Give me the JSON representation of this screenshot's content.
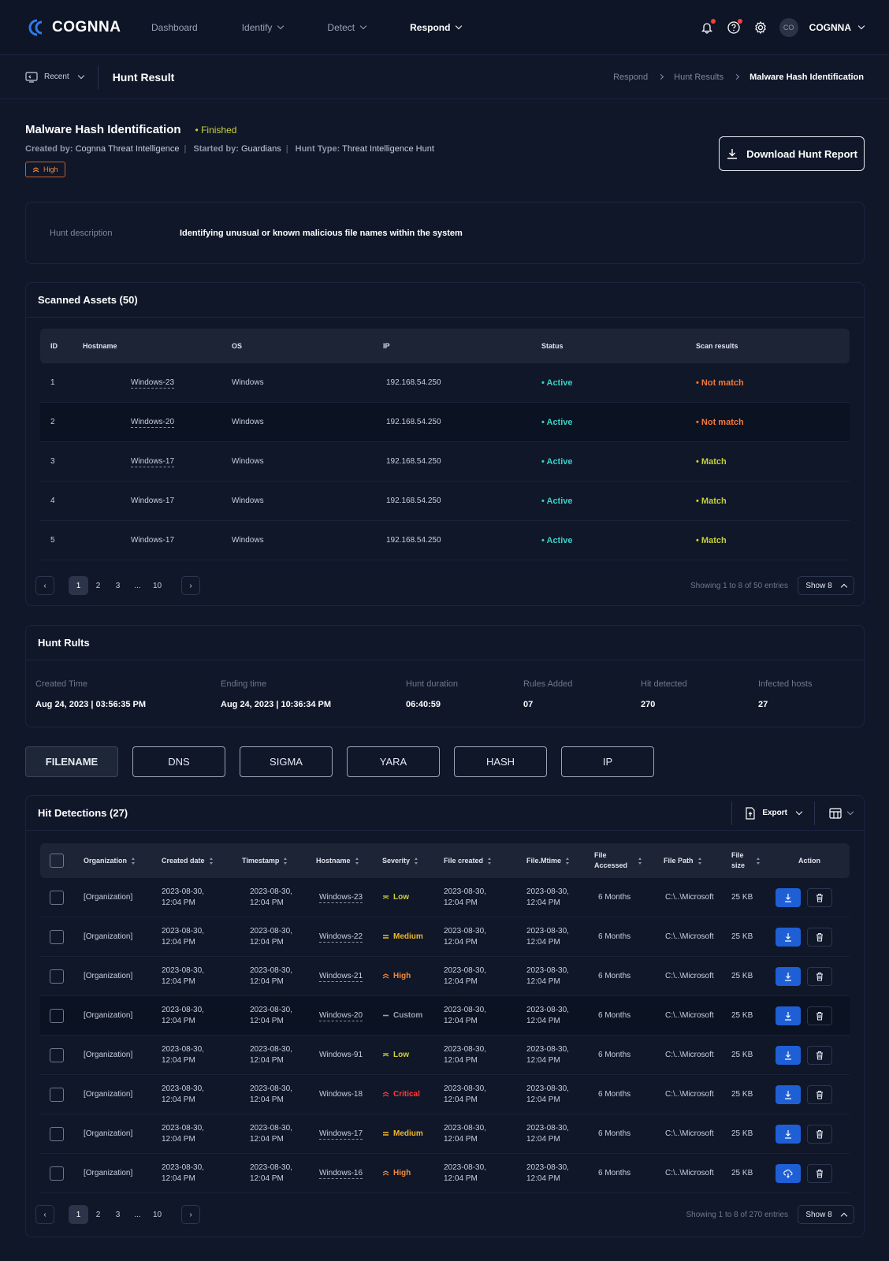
{
  "app": {
    "brand": "COGNNA"
  },
  "nav": {
    "items": [
      {
        "label": "Dashboard",
        "has_menu": false,
        "active": false
      },
      {
        "label": "Identify",
        "has_menu": true,
        "active": false
      },
      {
        "label": "Detect",
        "has_menu": true,
        "active": false
      },
      {
        "label": "Respond",
        "has_menu": true,
        "active": true
      }
    ]
  },
  "user": {
    "initials": "CO",
    "name": "COGNNA"
  },
  "subheader": {
    "recent_label": "Recent",
    "title": "Hunt Result"
  },
  "breadcrumb": [
    "Respond",
    "Hunt Results",
    "Malware Hash Identification"
  ],
  "hunt": {
    "title": "Malware Hash Identification",
    "status": "Finished",
    "created_by_label": "Created by:",
    "created_by": "Cognna Threat Intelligence",
    "started_by_label": "Started by:",
    "started_by": "Guardians",
    "type_label": "Hunt Type:",
    "type": "Threat Intelligence Hunt",
    "severity": "High",
    "download_label": "Download Hunt Report",
    "description_label": "Hunt description",
    "description": "Identifying unusual or known malicious file names within the system"
  },
  "assets": {
    "title": "Scanned Assets (50)",
    "columns": [
      "ID",
      "Hostname",
      "OS",
      "IP",
      "Status",
      "Scan results"
    ],
    "rows": [
      {
        "id": "1",
        "hostname": "Windows-23",
        "os": "Windows",
        "ip": "192.168.54.250",
        "status": "Active",
        "result": "Not match"
      },
      {
        "id": "2",
        "hostname": "Windows-20",
        "os": "Windows",
        "ip": "192.168.54.250",
        "status": "Active",
        "result": "Not match"
      },
      {
        "id": "3",
        "hostname": "Windows-17",
        "os": "Windows",
        "ip": "192.168.54.250",
        "status": "Active",
        "result": "Match"
      },
      {
        "id": "4",
        "hostname": "Windows-17",
        "os": "Windows",
        "ip": "192.168.54.250",
        "status": "Active",
        "result": "Match"
      },
      {
        "id": "5",
        "hostname": "Windows-17",
        "os": "Windows",
        "ip": "192.168.54.250",
        "status": "Active",
        "result": "Match"
      }
    ],
    "pages": [
      "1",
      "2",
      "3",
      "...",
      "10"
    ],
    "info": "Showing 1 to 8 of 50 entries",
    "show": "Show 8"
  },
  "results": {
    "title": "Hunt Rults",
    "items": [
      {
        "label": "Created Time",
        "value": "Aug 24, 2023 | 03:56:35 PM"
      },
      {
        "label": "Ending time",
        "value": "Aug 24, 2023 | 10:36:34 PM"
      },
      {
        "label": "Hunt duration",
        "value": "06:40:59"
      },
      {
        "label": "Rules Added",
        "value": "07"
      },
      {
        "label": "Hit detected",
        "value": "270"
      },
      {
        "label": "Infected hosts",
        "value": "27"
      }
    ]
  },
  "tabs": [
    "FILENAME",
    "DNS",
    "SIGMA",
    "YARA",
    "HASH",
    "IP"
  ],
  "detections": {
    "title": "Hit Detections (27)",
    "export_label": "Export",
    "columns": [
      "Organization",
      "Created date",
      "Timestamp",
      "Hostname",
      "Severity",
      "File created",
      "File.Mtime",
      "File Accessed",
      "File Path",
      "File size",
      "Action"
    ],
    "rows": [
      {
        "org": "[Organization]",
        "created": "2023-08-30,",
        "created_t": "12:04 PM",
        "ts": "2023-08-30,",
        "ts_t": "12:04 PM",
        "host": "Windows-23",
        "sev": "Low",
        "fc": "2023-08-30,",
        "fc_t": "12:04 PM",
        "fm": "2023-08-30,",
        "fm_t": "12:04 PM",
        "fa": "6 Months",
        "fp": "C:\\..\\Microsoft",
        "fs": "25 KB"
      },
      {
        "org": "[Organization]",
        "created": "2023-08-30,",
        "created_t": "12:04 PM",
        "ts": "2023-08-30,",
        "ts_t": "12:04 PM",
        "host": "Windows-22",
        "sev": "Medium",
        "fc": "2023-08-30,",
        "fc_t": "12:04 PM",
        "fm": "2023-08-30,",
        "fm_t": "12:04 PM",
        "fa": "6 Months",
        "fp": "C:\\..\\Microsoft",
        "fs": "25 KB"
      },
      {
        "org": "[Organization]",
        "created": "2023-08-30,",
        "created_t": "12:04 PM",
        "ts": "2023-08-30,",
        "ts_t": "12:04 PM",
        "host": "Windows-21",
        "sev": "High",
        "fc": "2023-08-30,",
        "fc_t": "12:04 PM",
        "fm": "2023-08-30,",
        "fm_t": "12:04 PM",
        "fa": "6 Months",
        "fp": "C:\\..\\Microsoft",
        "fs": "25 KB"
      },
      {
        "org": "[Organization]",
        "created": "2023-08-30,",
        "created_t": "12:04 PM",
        "ts": "2023-08-30,",
        "ts_t": "12:04 PM",
        "host": "Windows-20",
        "sev": "Custom",
        "fc": "2023-08-30,",
        "fc_t": "12:04 PM",
        "fm": "2023-08-30,",
        "fm_t": "12:04 PM",
        "fa": "6 Months",
        "fp": "C:\\..\\Microsoft",
        "fs": "25 KB"
      },
      {
        "org": "[Organization]",
        "created": "2023-08-30,",
        "created_t": "12:04 PM",
        "ts": "2023-08-30,",
        "ts_t": "12:04 PM",
        "host": "Windows-91",
        "sev": "Low",
        "fc": "2023-08-30,",
        "fc_t": "12:04 PM",
        "fm": "2023-08-30,",
        "fm_t": "12:04 PM",
        "fa": "6 Months",
        "fp": "C:\\..\\Microsoft",
        "fs": "25 KB"
      },
      {
        "org": "[Organization]",
        "created": "2023-08-30,",
        "created_t": "12:04 PM",
        "ts": "2023-08-30,",
        "ts_t": "12:04 PM",
        "host": "Windows-18",
        "sev": "Critical",
        "fc": "2023-08-30,",
        "fc_t": "12:04 PM",
        "fm": "2023-08-30,",
        "fm_t": "12:04 PM",
        "fa": "6 Months",
        "fp": "C:\\..\\Microsoft",
        "fs": "25 KB"
      },
      {
        "org": "[Organization]",
        "created": "2023-08-30,",
        "created_t": "12:04 PM",
        "ts": "2023-08-30,",
        "ts_t": "12:04 PM",
        "host": "Windows-17",
        "sev": "Medium",
        "fc": "2023-08-30,",
        "fc_t": "12:04 PM",
        "fm": "2023-08-30,",
        "fm_t": "12:04 PM",
        "fa": "6 Months",
        "fp": "C:\\..\\Microsoft",
        "fs": "25 KB"
      },
      {
        "org": "[Organization]",
        "created": "2023-08-30,",
        "created_t": "12:04 PM",
        "ts": "2023-08-30,",
        "ts_t": "12:04 PM",
        "host": "Windows-16",
        "sev": "High",
        "fc": "2023-08-30,",
        "fc_t": "12:04 PM",
        "fm": "2023-08-30,",
        "fm_t": "12:04 PM",
        "fa": "6 Months",
        "fp": "C:\\..\\Microsoft",
        "fs": "25 KB"
      }
    ],
    "pages": [
      "1",
      "2",
      "3",
      "...",
      "10"
    ],
    "info": "Showing 1 to 8 of 270 entries",
    "show": "Show 8"
  },
  "colors": {
    "accent": "#1f5fd6",
    "active": "#3ad0c6",
    "not_match": "#f07a3c",
    "match": "#c3cf3a",
    "finished": "#c9d23a"
  }
}
